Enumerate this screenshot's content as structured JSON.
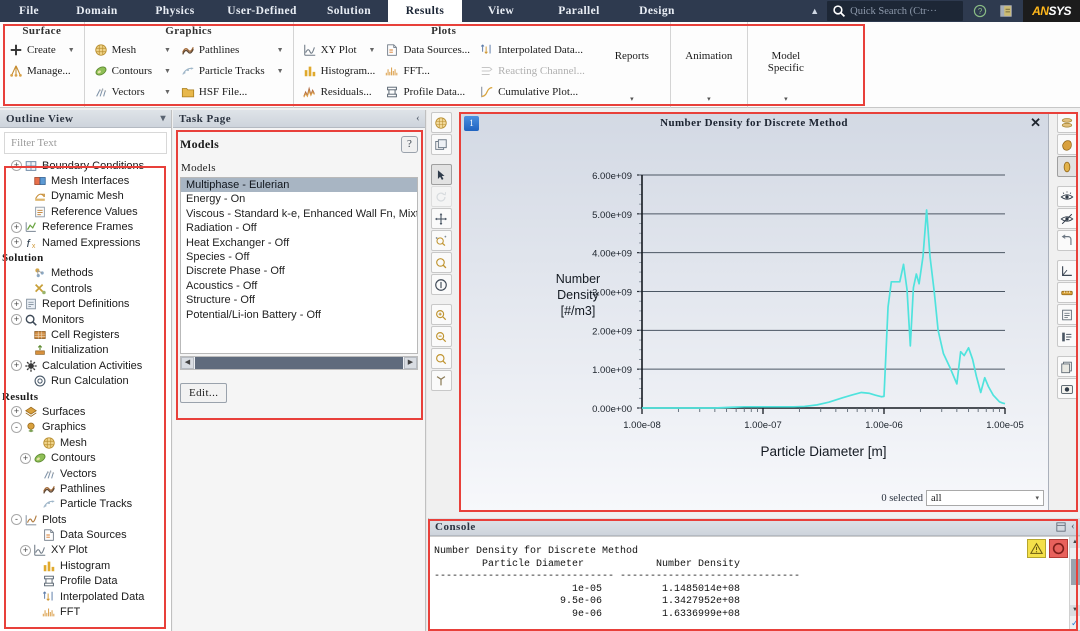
{
  "menubar": {
    "tabs": [
      {
        "label": "File",
        "active": false
      },
      {
        "label": "Domain",
        "active": false
      },
      {
        "label": "Physics",
        "active": false
      },
      {
        "label": "User-Defined",
        "active": false
      },
      {
        "label": "Solution",
        "active": false
      },
      {
        "label": "Results",
        "active": true
      },
      {
        "label": "View",
        "active": false
      },
      {
        "label": "Parallel",
        "active": false
      },
      {
        "label": "Design",
        "active": false
      }
    ],
    "collapse_caret": "▲",
    "quick_search_placeholder": "Quick Search (Ctr···",
    "search_icon": "search-icon",
    "help_icon": "help-circle-icon",
    "layout_icon": "layout-panel-icon",
    "brand_a": "AN",
    "brand_b": "SYS"
  },
  "ribbon": {
    "groups": [
      {
        "title": "Surface",
        "columns": [
          {
            "items": [
              {
                "label": "Create",
                "icon": "plus-icon",
                "caret": true,
                "disabled": false
              },
              {
                "label": "Manage...",
                "icon": "manage-surface-icon",
                "caret": false,
                "disabled": false
              }
            ]
          }
        ]
      },
      {
        "title": "Graphics",
        "columns": [
          {
            "items": [
              {
                "label": "Mesh",
                "icon": "mesh-icon",
                "caret": true,
                "disabled": false
              },
              {
                "label": "Contours",
                "icon": "contours-icon",
                "caret": true,
                "disabled": false
              },
              {
                "label": "Vectors",
                "icon": "vectors-icon",
                "caret": true,
                "disabled": false
              }
            ]
          },
          {
            "items": [
              {
                "label": "Pathlines",
                "icon": "pathlines-icon",
                "caret": true,
                "disabled": false
              },
              {
                "label": "Particle Tracks",
                "icon": "particle-tracks-icon",
                "caret": true,
                "disabled": false
              },
              {
                "label": "HSF File...",
                "icon": "folder-icon",
                "caret": false,
                "disabled": false
              }
            ]
          }
        ]
      },
      {
        "title": "Plots",
        "columns": [
          {
            "items": [
              {
                "label": "XY Plot",
                "icon": "xy-plot-icon",
                "caret": true,
                "disabled": false
              },
              {
                "label": "Histogram...",
                "icon": "histogram-icon",
                "caret": false,
                "disabled": false
              },
              {
                "label": "Residuals...",
                "icon": "residuals-icon",
                "caret": false,
                "disabled": false
              }
            ]
          },
          {
            "items": [
              {
                "label": "Data Sources...",
                "icon": "data-sources-icon",
                "caret": false,
                "disabled": false
              },
              {
                "label": "FFT...",
                "icon": "fft-icon",
                "caret": false,
                "disabled": false
              },
              {
                "label": "Profile Data...",
                "icon": "profile-data-icon",
                "caret": false,
                "disabled": false
              }
            ]
          },
          {
            "items": [
              {
                "label": "Interpolated Data...",
                "icon": "interpolated-data-icon",
                "caret": false,
                "disabled": false
              },
              {
                "label": "Reacting Channel...",
                "icon": "reacting-channel-icon",
                "caret": false,
                "disabled": true
              },
              {
                "label": "Cumulative Plot...",
                "icon": "cumulative-plot-icon",
                "caret": false,
                "disabled": false
              }
            ]
          }
        ]
      }
    ],
    "big_buttons": [
      {
        "label": "Reports",
        "caret": "▾"
      },
      {
        "label": "Animation",
        "caret": "▾"
      },
      {
        "label": "Model\nSpecific",
        "caret": "▾"
      }
    ]
  },
  "outline": {
    "title": "Outline View",
    "collapse_icon": "collapse-icon",
    "filter_placeholder": "Filter Text",
    "nodes": [
      {
        "label": "Boundary Conditions",
        "icon": "boundary-conditions-icon",
        "expander": "+",
        "indent": 1,
        "section": false
      },
      {
        "label": "Mesh Interfaces",
        "icon": "mesh-interfaces-icon",
        "expander": "",
        "indent": 2,
        "section": false
      },
      {
        "label": "Dynamic Mesh",
        "icon": "dynamic-mesh-icon",
        "expander": "",
        "indent": 2,
        "section": false
      },
      {
        "label": "Reference Values",
        "icon": "reference-values-icon",
        "expander": "",
        "indent": 2,
        "section": false
      },
      {
        "label": "Reference Frames",
        "icon": "reference-frames-icon",
        "expander": "+",
        "indent": 1,
        "section": false
      },
      {
        "label": "Named Expressions",
        "icon": "named-expressions-icon",
        "expander": "+",
        "indent": 1,
        "section": false
      },
      {
        "label": "Solution",
        "icon": "",
        "expander": "",
        "indent": 0,
        "section": true
      },
      {
        "label": "Methods",
        "icon": "methods-icon",
        "expander": "",
        "indent": 2,
        "section": false
      },
      {
        "label": "Controls",
        "icon": "controls-icon",
        "expander": "",
        "indent": 2,
        "section": false
      },
      {
        "label": "Report Definitions",
        "icon": "report-definitions-icon",
        "expander": "+",
        "indent": 1,
        "section": false
      },
      {
        "label": "Monitors",
        "icon": "monitors-icon",
        "expander": "+",
        "indent": 1,
        "section": false
      },
      {
        "label": "Cell Registers",
        "icon": "cell-registers-icon",
        "expander": "",
        "indent": 2,
        "section": false
      },
      {
        "label": "Initialization",
        "icon": "initialization-icon",
        "expander": "",
        "indent": 2,
        "section": false
      },
      {
        "label": "Calculation Activities",
        "icon": "calculation-activities-icon",
        "expander": "+",
        "indent": 1,
        "section": false
      },
      {
        "label": "Run Calculation",
        "icon": "run-calculation-icon",
        "expander": "",
        "indent": 2,
        "section": false
      },
      {
        "label": "Results",
        "icon": "",
        "expander": "",
        "indent": 0,
        "section": true
      },
      {
        "label": "Surfaces",
        "icon": "surfaces-icon",
        "expander": "+",
        "indent": 1,
        "section": false
      },
      {
        "label": "Graphics",
        "icon": "graphics-icon",
        "expander": "-",
        "indent": 1,
        "section": false
      },
      {
        "label": "Mesh",
        "icon": "mesh-icon",
        "expander": "",
        "indent": 3,
        "section": false
      },
      {
        "label": "Contours",
        "icon": "contours-icon",
        "expander": "+",
        "indent": 2,
        "section": false
      },
      {
        "label": "Vectors",
        "icon": "vectors-icon",
        "expander": "",
        "indent": 3,
        "section": false
      },
      {
        "label": "Pathlines",
        "icon": "pathlines-icon",
        "expander": "",
        "indent": 3,
        "section": false
      },
      {
        "label": "Particle Tracks",
        "icon": "particle-tracks-icon",
        "expander": "",
        "indent": 3,
        "section": false
      },
      {
        "label": "Plots",
        "icon": "plots-icon",
        "expander": "-",
        "indent": 1,
        "section": false
      },
      {
        "label": "Data Sources",
        "icon": "data-sources-icon",
        "expander": "",
        "indent": 3,
        "section": false
      },
      {
        "label": "XY Plot",
        "icon": "xy-plot-icon",
        "expander": "+",
        "indent": 2,
        "section": false
      },
      {
        "label": "Histogram",
        "icon": "histogram-icon",
        "expander": "",
        "indent": 3,
        "section": false
      },
      {
        "label": "Profile Data",
        "icon": "profile-data-icon",
        "expander": "",
        "indent": 3,
        "section": false
      },
      {
        "label": "Interpolated Data",
        "icon": "interpolated-data-icon",
        "expander": "",
        "indent": 3,
        "section": false
      },
      {
        "label": "FFT",
        "icon": "fft-icon",
        "expander": "",
        "indent": 3,
        "section": false
      }
    ]
  },
  "taskpage": {
    "title": "Task Page",
    "collapse_icon": "chevron-left-icon",
    "heading": "Models",
    "help_label": "?",
    "list_label": "Models",
    "models": [
      {
        "label": "Multiphase - Eulerian",
        "selected": true
      },
      {
        "label": "Energy - On",
        "selected": false
      },
      {
        "label": "Viscous - Standard k-e, Enhanced Wall Fn, Mixture",
        "selected": false
      },
      {
        "label": "Radiation - Off",
        "selected": false
      },
      {
        "label": "Heat Exchanger - Off",
        "selected": false
      },
      {
        "label": "Species - Off",
        "selected": false
      },
      {
        "label": "Discrete Phase - Off",
        "selected": false
      },
      {
        "label": "Acoustics - Off",
        "selected": false
      },
      {
        "label": "Structure - Off",
        "selected": false
      },
      {
        "label": "Potential/Li-ion Battery - Off",
        "selected": false
      }
    ],
    "edit_button": "Edit...",
    "scroll_left": "◀",
    "scroll_right": "▶"
  },
  "graphics": {
    "window_badge": "1",
    "title": "Number Density for Discrete Method",
    "close_label": "✕",
    "selected_label": "0 selected",
    "surface_value": "all",
    "caret": "▾",
    "left_tools": [
      {
        "name": "mesh-display-icon",
        "on": false
      },
      {
        "name": "copy-view-icon",
        "on": false
      },
      {
        "sep": true
      },
      {
        "name": "pointer-select-icon",
        "on": true
      },
      {
        "name": "rotate-view-icon",
        "on": false,
        "disabled": true
      },
      {
        "name": "pan-view-icon",
        "on": false
      },
      {
        "name": "zoom-field-icon",
        "on": false
      },
      {
        "name": "zoom-to-fit-icon",
        "on": false
      },
      {
        "name": "probe-info-icon",
        "on": false
      },
      {
        "sep": true
      },
      {
        "name": "zoom-in-icon",
        "on": false
      },
      {
        "name": "zoom-out-icon",
        "on": false
      },
      {
        "name": "zoom-reset-icon",
        "on": false
      },
      {
        "name": "axes-triad-icon",
        "on": false
      }
    ],
    "right_tools": [
      {
        "name": "view-isometric-icon",
        "on": false
      },
      {
        "name": "view-front-icon",
        "on": false
      },
      {
        "name": "view-side-icon",
        "on": true
      },
      {
        "sep": true
      },
      {
        "name": "visibility-on-icon",
        "on": false
      },
      {
        "name": "visibility-off-icon",
        "on": false
      },
      {
        "name": "undo-view-icon",
        "on": false
      },
      {
        "sep": true
      },
      {
        "name": "axes-icon",
        "on": false
      },
      {
        "name": "ruler-icon",
        "on": false
      },
      {
        "name": "legend-icon",
        "on": false
      },
      {
        "name": "colormap-icon",
        "on": false
      },
      {
        "sep": true
      },
      {
        "name": "copy-image-icon",
        "on": false
      },
      {
        "name": "camera-icon",
        "on": false
      }
    ]
  },
  "chart_data": {
    "type": "line",
    "title": "Number Density for Discrete Method",
    "xlabel": "Particle Diameter [m]",
    "ylabel": "Number\nDensity\n[#/m3]",
    "ylabel_lines": [
      "Number",
      "Density",
      "[#/m3]"
    ],
    "xscale": "log",
    "xlim": [
      1e-08,
      1e-05
    ],
    "ylim": [
      0,
      6000000000.0
    ],
    "xticks": [
      1e-08,
      1e-07,
      1e-06,
      1e-05
    ],
    "xtick_labels": [
      "1.00e-08",
      "1.00e-07",
      "1.00e-06",
      "1.00e-05"
    ],
    "yticks": [
      0,
      1000000000.0,
      2000000000.0,
      3000000000.0,
      4000000000.0,
      5000000000.0,
      6000000000.0
    ],
    "ytick_labels": [
      "0.00e+00",
      "1.00e+09",
      "2.00e+09",
      "3.00e+09",
      "4.00e+09",
      "5.00e+09",
      "6.00e+09"
    ],
    "grid": true,
    "line_color": "#4fe3dd",
    "series": [
      {
        "name": "Number Density",
        "x": [
          1e-08,
          2.5e-08,
          4e-08,
          5.5e-08,
          7e-08,
          9e-08,
          1.1e-07,
          1.4e-07,
          1.8e-07,
          2.2e-07,
          2.8e-07,
          3.5e-07,
          4.5e-07,
          5.5e-07,
          6.5e-07,
          7.5e-07,
          8.5e-07,
          9.5e-07,
          1e-06,
          1.08e-06,
          1.15e-06,
          1.25e-06,
          1.35e-06,
          1.45e-06,
          1.55e-06,
          1.65e-06,
          1.75e-06,
          1.85e-06,
          1.95e-06,
          2.1e-06,
          2.25e-06,
          2.4e-06,
          2.6e-06,
          2.8e-06,
          3.1e-06,
          3.5e-06,
          4e-06,
          4.3e-06,
          4.6e-06,
          5e-06,
          5.4e-06,
          5.8e-06,
          6.3e-06,
          6.8e-06,
          7.3e-06,
          8e-06,
          9e-06,
          9.5e-06,
          1e-05
        ],
        "y": [
          0.0,
          0.0,
          0.0,
          20000000.0,
          30000000.0,
          30000000.0,
          30000000.0,
          30000000.0,
          30000000.0,
          40000000.0,
          80000000.0,
          150000000.0,
          260000000.0,
          340000000.0,
          400000000.0,
          380000000.0,
          330000000.0,
          290000000.0,
          300000000.0,
          2600000000.0,
          3250000000.0,
          3250000000.0,
          3250000000.0,
          3700000000.0,
          3050000000.0,
          1600000000.0,
          3100000000.0,
          3450000000.0,
          3200000000.0,
          3900000000.0,
          5100000000.0,
          3900000000.0,
          3000000000.0,
          2000000000.0,
          1400000000.0,
          1050000000.0,
          620000000.0,
          1450000000.0,
          1350000000.0,
          1550000000.0,
          1250000000.0,
          820000000.0,
          400000000.0,
          780000000.0,
          550000000.0,
          330000000.0,
          160000000.0,
          130000000.0,
          110000000.0
        ]
      }
    ]
  },
  "console": {
    "title": "Console",
    "restore_icon": "restore-icon",
    "collapse_icon": "chevron-left-icon",
    "warning_icon": "warning-icon",
    "stop_icon": "stop-icon",
    "scroll_up": "▲",
    "scroll_down": "▼",
    "check_icon": "✓",
    "text": "Number Density for Discrete Method\n        Particle Diameter            Number Density\n------------------------------ ------------------------------\n                       1e-05          1.1485014e+08\n                     9.5e-06          1.3427952e+08\n                       9e-06          1.6336999e+08"
  },
  "colors": {
    "menubar_bg": "#2e3a4f",
    "accent_red": "#e8403a",
    "chart_line": "#4fe3dd",
    "selection_blue": "#a8b5c3",
    "brand_yellow": "#ffb71b"
  }
}
